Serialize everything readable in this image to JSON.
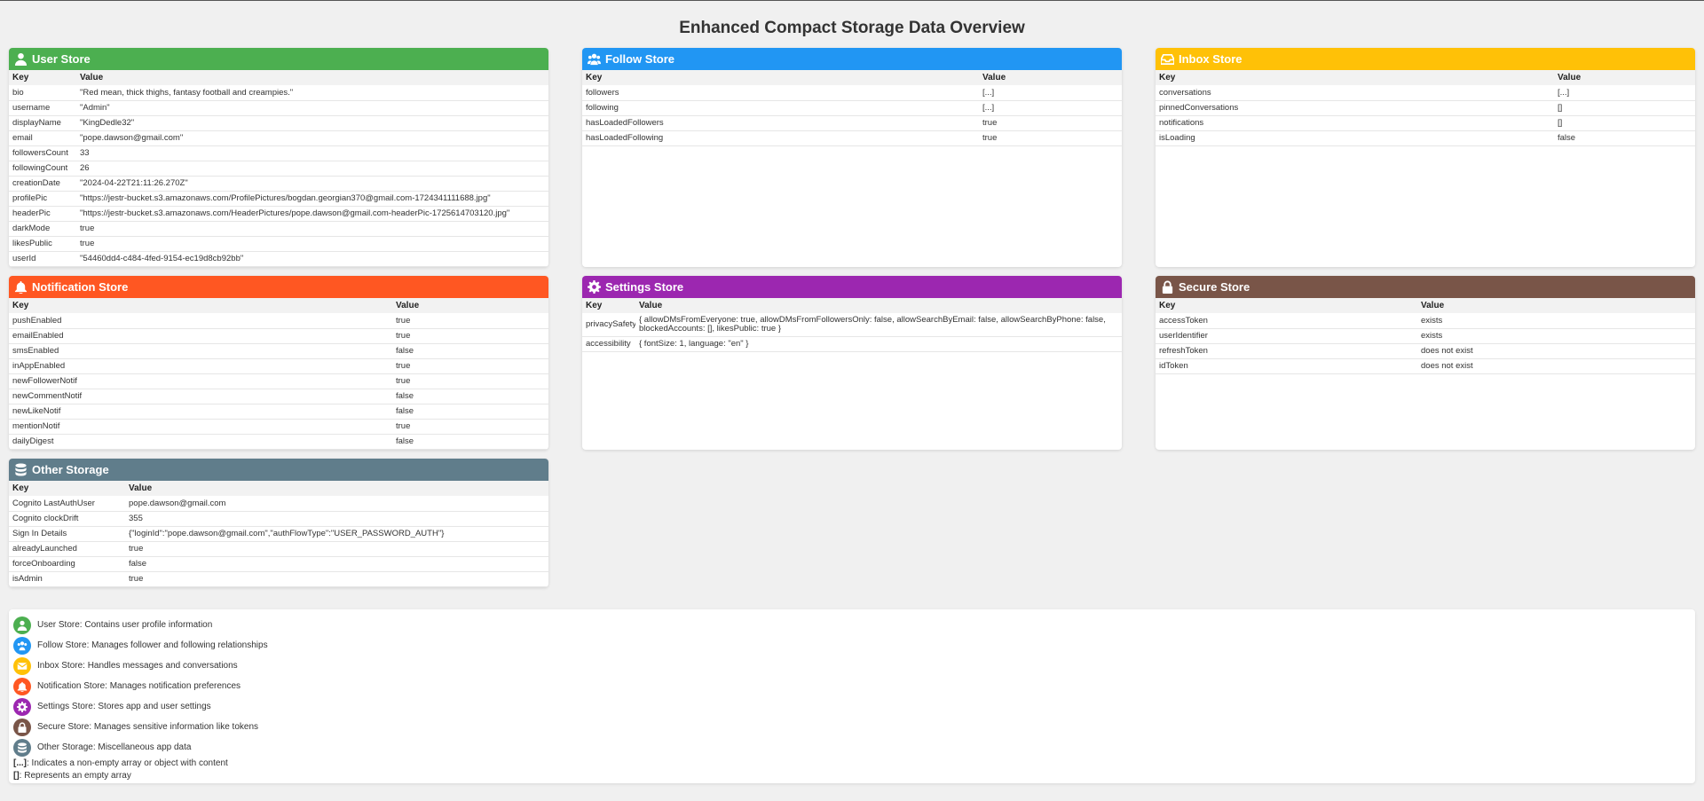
{
  "title": "Enhanced Compact Storage Data Overview",
  "colors": {
    "user": "#4caf50",
    "follow": "#2196f3",
    "inbox": "#ffc107",
    "notification": "#ff5722",
    "settings": "#9c27b0",
    "secure": "#795548",
    "other": "#607d8b"
  },
  "headers": {
    "key": "Key",
    "value": "Value"
  },
  "user_store": {
    "title": "User Store",
    "icon": "user-icon",
    "rows": [
      {
        "k": "bio",
        "v": "\"Red mean, thick thighs, fantasy football and creampies.\""
      },
      {
        "k": "username",
        "v": "\"Admin\""
      },
      {
        "k": "displayName",
        "v": "\"KingDedle32\""
      },
      {
        "k": "email",
        "v": "\"pope.dawson@gmail.com\""
      },
      {
        "k": "followersCount",
        "v": "33"
      },
      {
        "k": "followingCount",
        "v": "26"
      },
      {
        "k": "creationDate",
        "v": "\"2024-04-22T21:11:26.270Z\""
      },
      {
        "k": "profilePic",
        "v": "\"https://jestr-bucket.s3.amazonaws.com/ProfilePictures/bogdan.georgian370@gmail.com-1724341111688.jpg\""
      },
      {
        "k": "headerPic",
        "v": "\"https://jestr-bucket.s3.amazonaws.com/HeaderPictures/pope.dawson@gmail.com-headerPic-1725614703120.jpg\""
      },
      {
        "k": "darkMode",
        "v": "true"
      },
      {
        "k": "likesPublic",
        "v": "true"
      },
      {
        "k": "userId",
        "v": "\"54460dd4-c484-4fed-9154-ec19d8cb92bb\""
      }
    ]
  },
  "follow_store": {
    "title": "Follow Store",
    "icon": "users-icon",
    "rows": [
      {
        "k": "followers",
        "v": "[...]"
      },
      {
        "k": "following",
        "v": "[...]"
      },
      {
        "k": "hasLoadedFollowers",
        "v": "true"
      },
      {
        "k": "hasLoadedFollowing",
        "v": "true"
      }
    ]
  },
  "inbox_store": {
    "title": "Inbox Store",
    "icon": "inbox-icon",
    "rows": [
      {
        "k": "conversations",
        "v": "[...]"
      },
      {
        "k": "pinnedConversations",
        "v": "[]"
      },
      {
        "k": "notifications",
        "v": "[]"
      },
      {
        "k": "isLoading",
        "v": "false"
      }
    ]
  },
  "notification_store": {
    "title": "Notification Store",
    "icon": "bell-icon",
    "rows": [
      {
        "k": "pushEnabled",
        "v": "true"
      },
      {
        "k": "emailEnabled",
        "v": "true"
      },
      {
        "k": "smsEnabled",
        "v": "false"
      },
      {
        "k": "inAppEnabled",
        "v": "true"
      },
      {
        "k": "newFollowerNotif",
        "v": "true"
      },
      {
        "k": "newCommentNotif",
        "v": "false"
      },
      {
        "k": "newLikeNotif",
        "v": "false"
      },
      {
        "k": "mentionNotif",
        "v": "true"
      },
      {
        "k": "dailyDigest",
        "v": "false"
      }
    ]
  },
  "settings_store": {
    "title": "Settings Store",
    "icon": "gear-icon",
    "rows": [
      {
        "k": "privacySafety",
        "v": "{ allowDMsFromEveryone: true, allowDMsFromFollowersOnly: false, allowSearchByEmail: false, allowSearchByPhone: false, blockedAccounts: [], likesPublic: true }"
      },
      {
        "k": "accessibility",
        "v": "{ fontSize: 1, language: \"en\" }"
      }
    ]
  },
  "secure_store": {
    "title": "Secure Store",
    "icon": "lock-icon",
    "rows": [
      {
        "k": "accessToken",
        "v": "exists"
      },
      {
        "k": "userIdentifier",
        "v": "exists"
      },
      {
        "k": "refreshToken",
        "v": "does not exist"
      },
      {
        "k": "idToken",
        "v": "does not exist"
      }
    ]
  },
  "other_storage": {
    "title": "Other Storage",
    "icon": "database-icon",
    "rows": [
      {
        "k": "Cognito LastAuthUser",
        "v": "pope.dawson@gmail.com"
      },
      {
        "k": "Cognito clockDrift",
        "v": "355"
      },
      {
        "k": "Sign In Details",
        "v": "{\"loginId\":\"pope.dawson@gmail.com\",\"authFlowType\":\"USER_PASSWORD_AUTH\"}"
      },
      {
        "k": "alreadyLaunched",
        "v": "true"
      },
      {
        "k": "forceOnboarding",
        "v": "false"
      },
      {
        "k": "isAdmin",
        "v": "true"
      }
    ]
  },
  "legend": {
    "items": [
      {
        "text": "User Store: Contains user profile information",
        "icon": "user-icon"
      },
      {
        "text": "Follow Store: Manages follower and following relationships",
        "icon": "users-icon"
      },
      {
        "text": "Inbox Store: Handles messages and conversations",
        "icon": "inbox-icon"
      },
      {
        "text": "Notification Store: Manages notification preferences",
        "icon": "bell-icon"
      },
      {
        "text": "Settings Store: Stores app and user settings",
        "icon": "gear-icon"
      },
      {
        "text": "Secure Store: Manages sensitive information like tokens",
        "icon": "lock-icon"
      },
      {
        "text": "Other Storage: Miscellaneous app data",
        "icon": "database-icon"
      }
    ],
    "note1_symbol": "[...]",
    "note1_text": ": Indicates a non-empty array or object with content",
    "note2_symbol": "[]",
    "note2_text": ": Represents an empty array"
  }
}
